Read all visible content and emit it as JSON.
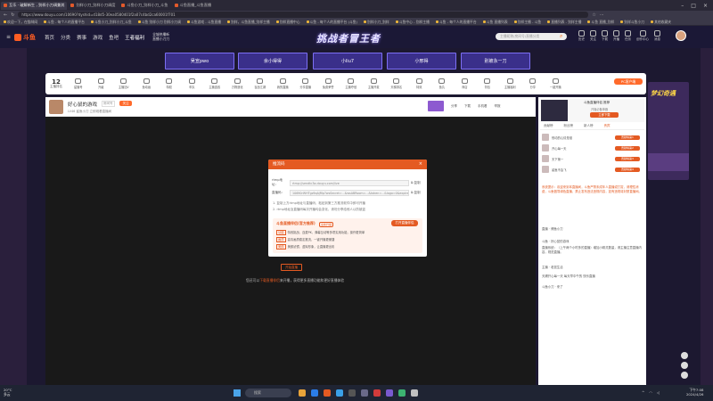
{
  "browser": {
    "tabs": [
      {
        "label": "互乐 · 破解新生 , 别样小刀调兼其",
        "active": true
      },
      {
        "label": "别样小刀_别样小刀调度",
        "active": false
      },
      {
        "label": "斗鱼小刀_别样小刀_斗鱼",
        "active": false
      },
      {
        "label": "斗鱼直播_斗鱼直播",
        "active": false
      }
    ],
    "url": "https://www.douyu.com/10690?dyshid=d18d5-30ea0580401f2a07c4bd2ca60001f701",
    "bookmarks": [
      "欢迎一下，在猫咪网",
      "斗鱼 - 每个人的直播平台",
      "斗鱼小刀_别样小刀_斗鱼",
      "斗鱼 别样小刀 别样小刀调",
      "斗鱼游戏 - 斗鱼直播",
      "别样，斗鱼直播_别样主播",
      "别样直播中心",
      "斗鱼 - 每个人的直播平台 (斗鱼)",
      "别样小刀_别样",
      "斗鱼中心 - 别样主播",
      "斗鱼 - 每个人的直播平台",
      "斗鱼 直播列表",
      "别样主播 - 斗鱼",
      "直播列表 - 别样主播",
      "斗鱼 直播_别样",
      "别样斗鱼小刀",
      "其他收藏夹"
    ]
  },
  "header": {
    "logo": "斗鱼",
    "nav": [
      "首页",
      "分类",
      "赛事",
      "游戏",
      "鱼吧",
      "王者福利"
    ],
    "promo": [
      "全城热播新",
      "直播小刀刀"
    ],
    "banner": "挑战者冒王者",
    "search_placeholder": "主播昵称/房间号/直播分类",
    "icons": [
      "历史",
      "关注",
      "下载",
      "开播",
      "任务",
      "创作中心",
      "消息"
    ]
  },
  "anchors": [
    "吴宣pwo",
    "余小得得",
    "小liu7",
    "小邢得",
    "别被永一刀"
  ],
  "catbar": {
    "rank": "12",
    "rank_label": "主播排名",
    "items": [
      "星播号",
      "升级",
      "主播加V",
      "鱼动画",
      "特权",
      "车队",
      "主播连线",
      "万物造化",
      "百战江湖",
      "我的直播",
      "分享直播",
      "免费荣誉",
      "主播夺冠",
      "主播开麦",
      "天梯排名",
      "特效",
      "鱼丸",
      "商店",
      "背包",
      "主播福利",
      "分享",
      "一键开播"
    ],
    "pc_button": "PC客户端"
  },
  "room": {
    "anchor_name": "好心鼠的游戏",
    "anchor_tag": "房间号",
    "follow": "关注",
    "sub": "LV46  鲨鱼小刀  立即观看直播间",
    "tools": [
      "分享",
      "下载",
      "手机看",
      "举报"
    ]
  },
  "modal": {
    "title": "推流码",
    "rtmp_label": "rtmp地址：",
    "rtmp_value": "rtmp://sendtc3a.douyu.com/live",
    "key_label": "直播码：",
    "key_value": "10690rWHTgz9qAjRIp?wsSecret=...&wsABRoom=...&token=...&logo=0&expire=0&did=0",
    "copy": "复制",
    "note1": "1. 复制上方rtmp地址与直播码，粘贴到第三方推流软件中即可开播",
    "note2": "2. rtmp地址及直播码每次开播均会变化，请勿分享给他人以防被盗",
    "tips_title": "斗鱼直播伴侣(官方推荐)",
    "tips_sub": "全新升级",
    "tips_button": "打开直播伴侣",
    "tips": [
      {
        "tag": "功能",
        "text": "特效挑战、连麦PK、弹幕互动等多项实用功能，操作更简单"
      },
      {
        "tag": "画质",
        "text": "高清画质稳定推流，一键开播更便捷"
      },
      {
        "tag": "美颜",
        "text": "美颜滤镜、虚拟形象，让直播更出彩"
      }
    ]
  },
  "live_status": {
    "button": "开始直播",
    "message_pre": "您还可以",
    "message_link": "下载直播伴侣",
    "message_post": "来开播，获得更多直播功能和更好直播体验"
  },
  "right": {
    "ad_title": "斗鱼直播伴侣 推荐",
    "ad_sub": "开播必备神器",
    "ad_button": "立即下载",
    "tabs": [
      "贡献榜",
      "粉丝榜",
      "新人榜",
      "贵宾"
    ],
    "ranks": [
      {
        "name": "别动的心情是谁",
        "badge": "贡献榜第1"
      },
      {
        "name": "开心每一天",
        "badge": "贡献榜第2"
      },
      {
        "name": "天下第一",
        "badge": "贡献榜第3"
      },
      {
        "name": "鲨鱼不会飞",
        "badge": "贡献榜第4"
      }
    ],
    "chat_system": "系统提示：欢迎来到本直播间，斗鱼严禁未成年人直播或打赏，请理性消费，斗鱼倡导绿色直播，禁止发布违法违规内容，如有违规将封禁直播间。",
    "chat_lines": [
      "直播 · 博鱼小刀",
      "斗鱼 · 好心鼠的游戏",
      "直播系统：（上午两个小时多的直播）增加小精灵数量，请主播注意直播内容，规范直播。",
      "主播 · 老鼠生活",
      "天赐开心每一天 每天早中午的 快乐直播",
      "斗鱼小刀 · 来了"
    ],
    "tower_title": "梦幻奇遇"
  },
  "taskbar": {
    "weather_temp": "20°C",
    "weather_desc": "多云",
    "search": "搜索",
    "time": "下午7:08",
    "date": "2024/4/26"
  },
  "colors": {
    "accent": "#e45a22",
    "anchor_box": "#3a2f8a",
    "page_bg": "#1c1830"
  }
}
